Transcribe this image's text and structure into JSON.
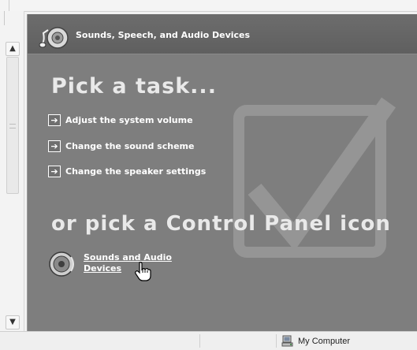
{
  "header": {
    "title": "Sounds, Speech, and Audio Devices",
    "icon": "speaker-notes-icon"
  },
  "tasks": {
    "heading": "Pick a task...",
    "items": [
      {
        "label": "Adjust the system volume",
        "icon": "arrow-right-icon"
      },
      {
        "label": "Change the sound scheme",
        "icon": "arrow-right-icon"
      },
      {
        "label": "Change the speaker settings",
        "icon": "arrow-right-icon"
      }
    ]
  },
  "control_panel": {
    "heading": "or pick a Control Panel icon",
    "items": [
      {
        "label": "Sounds and Audio Devices",
        "icon": "speaker-icon"
      }
    ]
  },
  "statusbar": {
    "zone": "My Computer",
    "icon": "computer-icon"
  },
  "colors": {
    "panel_bg": "#7e7e7e",
    "header_bg": "#5f5f5f",
    "text": "#ffffff",
    "heading_text": "#e9e9e9"
  }
}
